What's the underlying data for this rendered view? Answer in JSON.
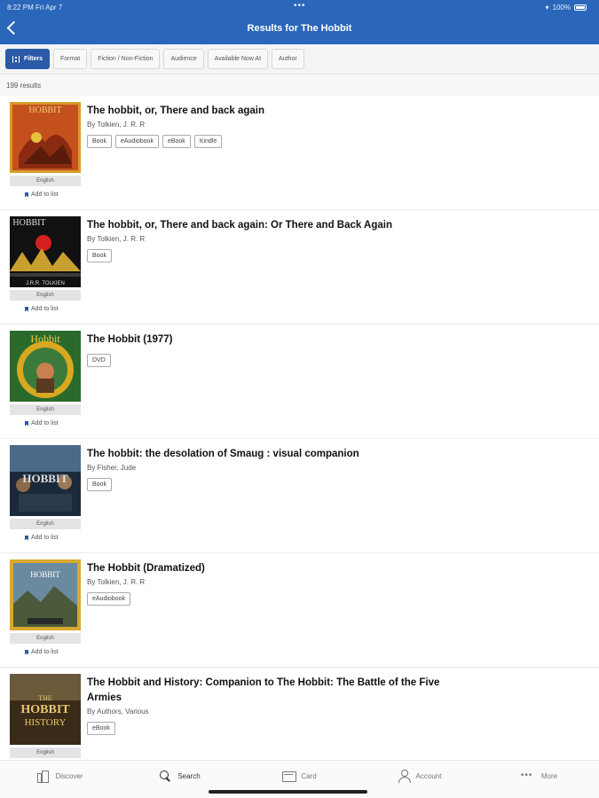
{
  "status_bar": {
    "time": "8:22 PM   Fri Apr 7",
    "dots": "•••",
    "battery": "100%"
  },
  "header": {
    "title": "Results for The Hobbit"
  },
  "filters": [
    {
      "label": "Filters",
      "primary": true
    },
    {
      "label": "Format"
    },
    {
      "label": "Fiction / Non-Fiction"
    },
    {
      "label": "Audience"
    },
    {
      "label": "Available Now At"
    },
    {
      "label": "Author"
    }
  ],
  "results_count": "199 results",
  "add_to_list_label": "Add to list",
  "results": [
    {
      "title": "The hobbit, or, There and back again",
      "author": "By Tolkien, J. R. R",
      "formats": [
        "Book",
        "eAudiobook",
        "eBook",
        "Kindle"
      ],
      "language": "English",
      "cover_icon": "book-cover-orange-dragon"
    },
    {
      "title": "The hobbit, or, There and back again: Or There and Back Again",
      "author": "By Tolkien, J. R. R",
      "formats": [
        "Book"
      ],
      "language": "English",
      "cover_icon": "book-cover-black-mountains"
    },
    {
      "title": "The Hobbit (1977)",
      "author": "",
      "formats": [
        "DVD"
      ],
      "language": "English",
      "cover_icon": "dvd-cover-green-gold"
    },
    {
      "title": "The hobbit: the desolation of Smaug : visual companion",
      "author": "By Fisher, Jude",
      "formats": [
        "Book"
      ],
      "language": "English",
      "cover_icon": "book-cover-blue-movie"
    },
    {
      "title": "The Hobbit (Dramatized)",
      "author": "By Tolkien, J. R. R",
      "formats": [
        "eAudiobook"
      ],
      "language": "English",
      "cover_icon": "audiobook-cover-painting"
    },
    {
      "title": "The Hobbit and History: Companion to The Hobbit: The Battle of the Five Armies",
      "author": "By Authors, Various",
      "formats": [
        "eBook"
      ],
      "language": "English",
      "cover_icon": "book-cover-gold-title"
    }
  ],
  "tabs": [
    {
      "label": "Discover",
      "icon": "discover-icon"
    },
    {
      "label": "Search",
      "icon": "search-icon",
      "active": true
    },
    {
      "label": "Card",
      "icon": "card-icon"
    },
    {
      "label": "Account",
      "icon": "account-icon"
    },
    {
      "label": "More",
      "icon": "more-icon"
    }
  ],
  "colors": {
    "header": "#2a66b9",
    "accent": "#2a5aa8"
  }
}
